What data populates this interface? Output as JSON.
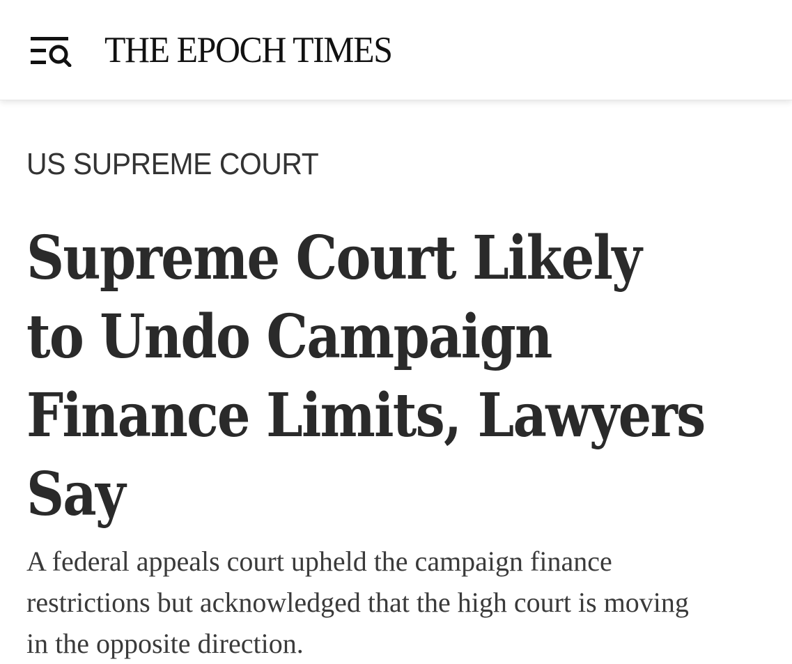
{
  "header": {
    "menu_search_icon": "menu-search-icon",
    "brand": "THE EPOCH TIMES"
  },
  "article": {
    "section": "US SUPREME COURT",
    "headline_lines": [
      "Supreme Court Likely",
      "to Undo Campaign",
      "Finance Limits, Lawyers",
      "Say"
    ],
    "subhead_lines": [
      "A federal appeals court upheld the campaign finance",
      "restrictions but acknowledged that the high court is moving",
      "in the opposite direction."
    ]
  },
  "colors": {
    "text_dark": "#2a2a2a",
    "brand_text": "#111111",
    "background": "#ffffff"
  }
}
